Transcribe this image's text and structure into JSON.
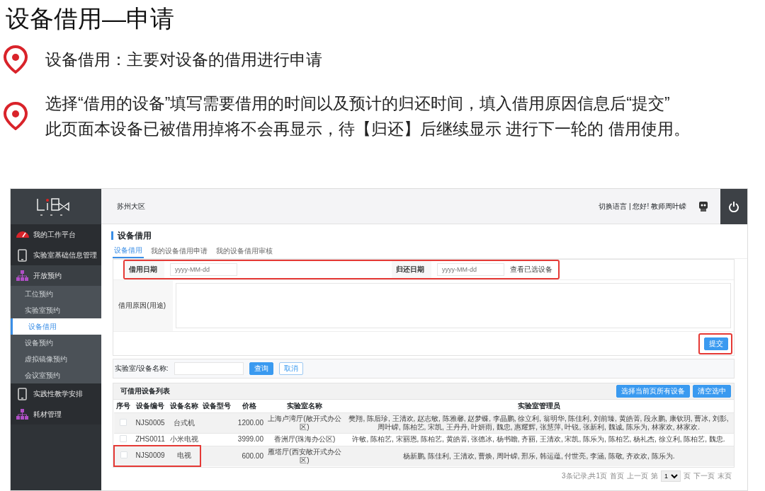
{
  "slide": {
    "title": "设备借用—申请",
    "bullets": [
      {
        "lines": [
          "设备借用：主要对设备的借用进行申请"
        ]
      },
      {
        "lines": [
          "选择“借用的设备”填写需要借用的时间以及预计的归还时间，填入借用原因信息后“提交”",
          "此页面本设备已被借用掉将不会再显示，待【归还】后继续显示  进行下一轮的  借用使用。"
        ]
      }
    ]
  },
  "app": {
    "region": "苏州大区",
    "user_links": "切换语言 | 您好! 教师周叶嵘",
    "sidebar": [
      {
        "label": "我的工作平台",
        "kind": "gauge"
      },
      {
        "label": "实验室基础信息管理",
        "kind": "tablet"
      },
      {
        "label": "开放预约",
        "kind": "hierarchy",
        "expanded": true,
        "children": [
          {
            "label": "工位预约",
            "selected": false
          },
          {
            "label": "实验室预约",
            "selected": false
          },
          {
            "label": "设备借用",
            "selected": true
          },
          {
            "label": "设备预约",
            "selected": false
          },
          {
            "label": "虚拟镜像预约",
            "selected": false
          },
          {
            "label": "会议室预约",
            "selected": false
          }
        ]
      },
      {
        "label": "实践性教学安排",
        "kind": "tablet"
      },
      {
        "label": "耗材管理",
        "kind": "hierarchy"
      }
    ],
    "page_title": "设备借用",
    "tabs": [
      {
        "label": "设备借用",
        "selected": true
      },
      {
        "label": "我的设备借用申请",
        "selected": false
      },
      {
        "label": "我的设备借用审核",
        "selected": false
      }
    ],
    "form": {
      "borrow_date": {
        "label": "借用日期",
        "placeholder": "yyyy-MM-dd"
      },
      "return_date": {
        "label": "归还日期",
        "placeholder": "yyyy-MM-dd"
      },
      "view_selected": "查看已选设备",
      "dates_highlighted": true,
      "reason_label": "借用原因(用途)",
      "submit": "提交",
      "submit_highlighted": true
    },
    "search": {
      "label": "实验室/设备名称:",
      "buttons": [
        {
          "label": "查询",
          "kind": "primary"
        },
        {
          "label": "取消",
          "kind": "outline"
        }
      ]
    },
    "list": {
      "title": "可借用设备列表",
      "actions": [
        "选择当前页所有设备",
        "清空选中"
      ],
      "columns": [
        "序号",
        "设备编号",
        "设备名称",
        "设备型号",
        "价格",
        "实验室名称",
        "实验室管理员"
      ],
      "rows": [
        {
          "checked": false,
          "highlighted": false,
          "code": "NJS0005",
          "name": "台式机",
          "price": "1200.00",
          "lab": "上海卢湾厅(敞开式办公区)",
          "managers": "樊翔, 陈后珍, 王清欢, 赵志敏, 陈雅馨, 赵梦蝶, 李晶鹏, 徐立利, 翁明华, 陈佳利, 刘前臻, 黄皓菁, 段永鹏, 康钦玥, 曹冰, 刘影, 周叶嵘, 陈柏艺, 宋凯, 王丹丹, 叶妍雨, 魏忠, 惠耀辉, 张慧萍, 叶锐, 张新利, 魏诚, 陈乐为, 林家欢, 林家欢."
        },
        {
          "checked": false,
          "highlighted": false,
          "code": "ZHS0011",
          "name": "小米电视",
          "price": "3999.00",
          "lab": "香洲厅(珠海办公区)",
          "managers": "许敏, 陈柏艺, 宋丽恩, 陈柏艺, 黄皓菁, 张德冰, 杨书瞻, 齐丽, 王清欢, 宋凯, 陈乐为, 陈柏艺, 杨礼杰, 徐立利, 陈柏艺, 魏忠."
        },
        {
          "checked": false,
          "highlighted": true,
          "code": "NJS0009",
          "name": "电视",
          "price": "600.00",
          "lab": "雁塔厅(西安敞开式办公区)",
          "managers": "杨新鹏, 陈佳利, 王清欢, 曹焕, 周叶嵘, 邢乐, 韩运蕴, 付世亮, 李涵, 陈敬, 齐欢欢, 陈乐为."
        }
      ]
    },
    "pagination": {
      "summary": "3条记录,共1页",
      "first": "首页",
      "prev": "上一页",
      "page_prefix": "第",
      "page": "1",
      "page_suffix": "页",
      "next": "下一页",
      "last": "末页"
    }
  }
}
